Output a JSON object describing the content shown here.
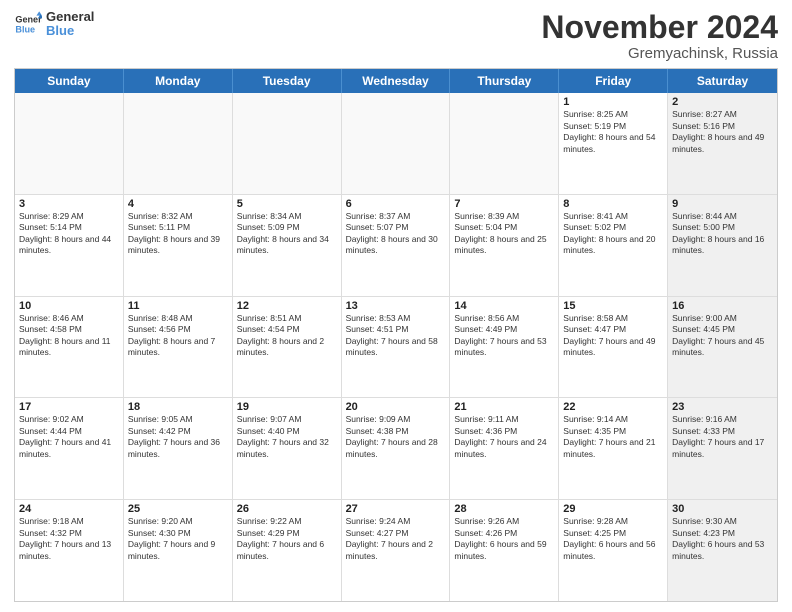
{
  "header": {
    "logo_line1": "General",
    "logo_line2": "Blue",
    "month": "November 2024",
    "location": "Gremyachinsk, Russia"
  },
  "weekdays": [
    "Sunday",
    "Monday",
    "Tuesday",
    "Wednesday",
    "Thursday",
    "Friday",
    "Saturday"
  ],
  "rows": [
    [
      {
        "day": "",
        "sunrise": "",
        "sunset": "",
        "daylight": "",
        "shaded": false,
        "empty": true
      },
      {
        "day": "",
        "sunrise": "",
        "sunset": "",
        "daylight": "",
        "shaded": false,
        "empty": true
      },
      {
        "day": "",
        "sunrise": "",
        "sunset": "",
        "daylight": "",
        "shaded": false,
        "empty": true
      },
      {
        "day": "",
        "sunrise": "",
        "sunset": "",
        "daylight": "",
        "shaded": false,
        "empty": true
      },
      {
        "day": "",
        "sunrise": "",
        "sunset": "",
        "daylight": "",
        "shaded": false,
        "empty": true
      },
      {
        "day": "1",
        "sunrise": "Sunrise: 8:25 AM",
        "sunset": "Sunset: 5:19 PM",
        "daylight": "Daylight: 8 hours and 54 minutes.",
        "shaded": false,
        "empty": false
      },
      {
        "day": "2",
        "sunrise": "Sunrise: 8:27 AM",
        "sunset": "Sunset: 5:16 PM",
        "daylight": "Daylight: 8 hours and 49 minutes.",
        "shaded": true,
        "empty": false
      }
    ],
    [
      {
        "day": "3",
        "sunrise": "Sunrise: 8:29 AM",
        "sunset": "Sunset: 5:14 PM",
        "daylight": "Daylight: 8 hours and 44 minutes.",
        "shaded": false,
        "empty": false
      },
      {
        "day": "4",
        "sunrise": "Sunrise: 8:32 AM",
        "sunset": "Sunset: 5:11 PM",
        "daylight": "Daylight: 8 hours and 39 minutes.",
        "shaded": false,
        "empty": false
      },
      {
        "day": "5",
        "sunrise": "Sunrise: 8:34 AM",
        "sunset": "Sunset: 5:09 PM",
        "daylight": "Daylight: 8 hours and 34 minutes.",
        "shaded": false,
        "empty": false
      },
      {
        "day": "6",
        "sunrise": "Sunrise: 8:37 AM",
        "sunset": "Sunset: 5:07 PM",
        "daylight": "Daylight: 8 hours and 30 minutes.",
        "shaded": false,
        "empty": false
      },
      {
        "day": "7",
        "sunrise": "Sunrise: 8:39 AM",
        "sunset": "Sunset: 5:04 PM",
        "daylight": "Daylight: 8 hours and 25 minutes.",
        "shaded": false,
        "empty": false
      },
      {
        "day": "8",
        "sunrise": "Sunrise: 8:41 AM",
        "sunset": "Sunset: 5:02 PM",
        "daylight": "Daylight: 8 hours and 20 minutes.",
        "shaded": false,
        "empty": false
      },
      {
        "day": "9",
        "sunrise": "Sunrise: 8:44 AM",
        "sunset": "Sunset: 5:00 PM",
        "daylight": "Daylight: 8 hours and 16 minutes.",
        "shaded": true,
        "empty": false
      }
    ],
    [
      {
        "day": "10",
        "sunrise": "Sunrise: 8:46 AM",
        "sunset": "Sunset: 4:58 PM",
        "daylight": "Daylight: 8 hours and 11 minutes.",
        "shaded": false,
        "empty": false
      },
      {
        "day": "11",
        "sunrise": "Sunrise: 8:48 AM",
        "sunset": "Sunset: 4:56 PM",
        "daylight": "Daylight: 8 hours and 7 minutes.",
        "shaded": false,
        "empty": false
      },
      {
        "day": "12",
        "sunrise": "Sunrise: 8:51 AM",
        "sunset": "Sunset: 4:54 PM",
        "daylight": "Daylight: 8 hours and 2 minutes.",
        "shaded": false,
        "empty": false
      },
      {
        "day": "13",
        "sunrise": "Sunrise: 8:53 AM",
        "sunset": "Sunset: 4:51 PM",
        "daylight": "Daylight: 7 hours and 58 minutes.",
        "shaded": false,
        "empty": false
      },
      {
        "day": "14",
        "sunrise": "Sunrise: 8:56 AM",
        "sunset": "Sunset: 4:49 PM",
        "daylight": "Daylight: 7 hours and 53 minutes.",
        "shaded": false,
        "empty": false
      },
      {
        "day": "15",
        "sunrise": "Sunrise: 8:58 AM",
        "sunset": "Sunset: 4:47 PM",
        "daylight": "Daylight: 7 hours and 49 minutes.",
        "shaded": false,
        "empty": false
      },
      {
        "day": "16",
        "sunrise": "Sunrise: 9:00 AM",
        "sunset": "Sunset: 4:45 PM",
        "daylight": "Daylight: 7 hours and 45 minutes.",
        "shaded": true,
        "empty": false
      }
    ],
    [
      {
        "day": "17",
        "sunrise": "Sunrise: 9:02 AM",
        "sunset": "Sunset: 4:44 PM",
        "daylight": "Daylight: 7 hours and 41 minutes.",
        "shaded": false,
        "empty": false
      },
      {
        "day": "18",
        "sunrise": "Sunrise: 9:05 AM",
        "sunset": "Sunset: 4:42 PM",
        "daylight": "Daylight: 7 hours and 36 minutes.",
        "shaded": false,
        "empty": false
      },
      {
        "day": "19",
        "sunrise": "Sunrise: 9:07 AM",
        "sunset": "Sunset: 4:40 PM",
        "daylight": "Daylight: 7 hours and 32 minutes.",
        "shaded": false,
        "empty": false
      },
      {
        "day": "20",
        "sunrise": "Sunrise: 9:09 AM",
        "sunset": "Sunset: 4:38 PM",
        "daylight": "Daylight: 7 hours and 28 minutes.",
        "shaded": false,
        "empty": false
      },
      {
        "day": "21",
        "sunrise": "Sunrise: 9:11 AM",
        "sunset": "Sunset: 4:36 PM",
        "daylight": "Daylight: 7 hours and 24 minutes.",
        "shaded": false,
        "empty": false
      },
      {
        "day": "22",
        "sunrise": "Sunrise: 9:14 AM",
        "sunset": "Sunset: 4:35 PM",
        "daylight": "Daylight: 7 hours and 21 minutes.",
        "shaded": false,
        "empty": false
      },
      {
        "day": "23",
        "sunrise": "Sunrise: 9:16 AM",
        "sunset": "Sunset: 4:33 PM",
        "daylight": "Daylight: 7 hours and 17 minutes.",
        "shaded": true,
        "empty": false
      }
    ],
    [
      {
        "day": "24",
        "sunrise": "Sunrise: 9:18 AM",
        "sunset": "Sunset: 4:32 PM",
        "daylight": "Daylight: 7 hours and 13 minutes.",
        "shaded": false,
        "empty": false
      },
      {
        "day": "25",
        "sunrise": "Sunrise: 9:20 AM",
        "sunset": "Sunset: 4:30 PM",
        "daylight": "Daylight: 7 hours and 9 minutes.",
        "shaded": false,
        "empty": false
      },
      {
        "day": "26",
        "sunrise": "Sunrise: 9:22 AM",
        "sunset": "Sunset: 4:29 PM",
        "daylight": "Daylight: 7 hours and 6 minutes.",
        "shaded": false,
        "empty": false
      },
      {
        "day": "27",
        "sunrise": "Sunrise: 9:24 AM",
        "sunset": "Sunset: 4:27 PM",
        "daylight": "Daylight: 7 hours and 2 minutes.",
        "shaded": false,
        "empty": false
      },
      {
        "day": "28",
        "sunrise": "Sunrise: 9:26 AM",
        "sunset": "Sunset: 4:26 PM",
        "daylight": "Daylight: 6 hours and 59 minutes.",
        "shaded": false,
        "empty": false
      },
      {
        "day": "29",
        "sunrise": "Sunrise: 9:28 AM",
        "sunset": "Sunset: 4:25 PM",
        "daylight": "Daylight: 6 hours and 56 minutes.",
        "shaded": false,
        "empty": false
      },
      {
        "day": "30",
        "sunrise": "Sunrise: 9:30 AM",
        "sunset": "Sunset: 4:23 PM",
        "daylight": "Daylight: 6 hours and 53 minutes.",
        "shaded": true,
        "empty": false
      }
    ]
  ]
}
